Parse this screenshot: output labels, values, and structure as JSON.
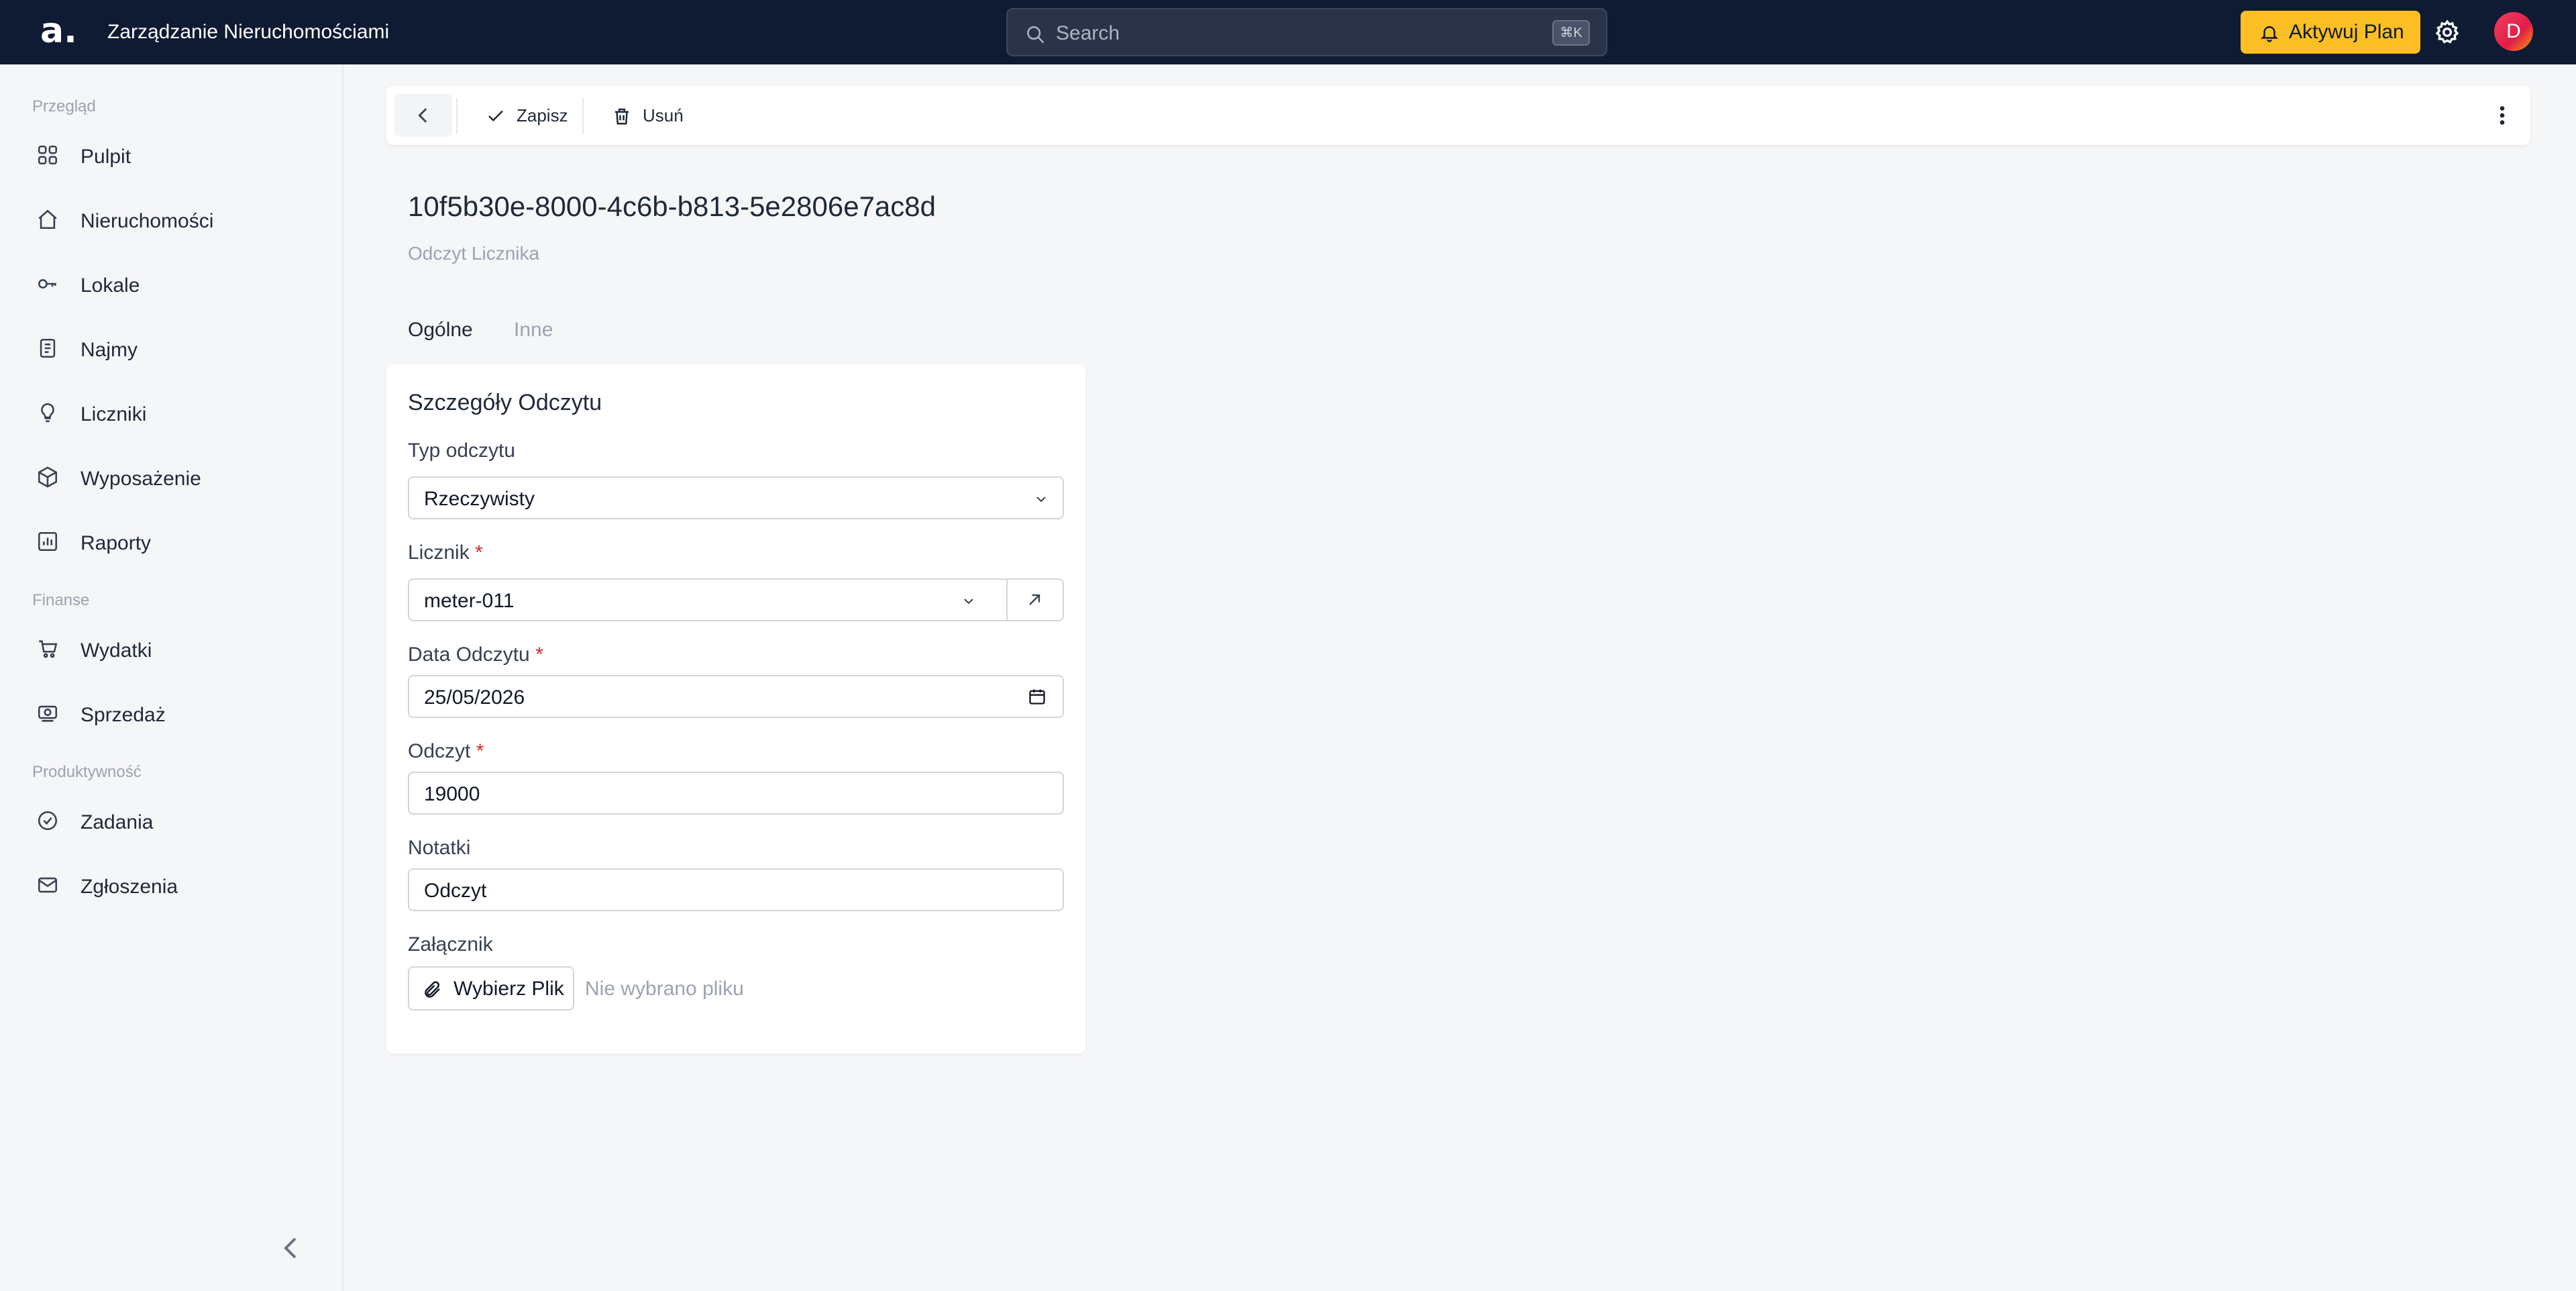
{
  "header": {
    "logo": "a.",
    "app_title": "Zarządzanie Nieruchomościami",
    "search_placeholder": "Search",
    "search_shortcut": "⌘K",
    "upgrade_label": "Aktywuj Plan",
    "avatar_initial": "D",
    "colors": {
      "bar": "#0f1a33",
      "upgrade": "#fbbf24"
    }
  },
  "sidebar": {
    "sections": [
      {
        "label": "Przegląd",
        "items": [
          "Pulpit",
          "Nieruchomości",
          "Lokale",
          "Najmy",
          "Liczniki",
          "Wyposażenie",
          "Raporty"
        ]
      },
      {
        "label": "Finanse",
        "items": [
          "Wydatki",
          "Sprzedaż"
        ]
      },
      {
        "label": "Produktywność",
        "items": [
          "Zadania",
          "Zgłoszenia"
        ]
      }
    ],
    "icons": [
      "grid-icon",
      "house-icon",
      "key-icon",
      "document-icon",
      "lightbulb-icon",
      "box-icon",
      "chart-icon",
      "cart-icon",
      "cash-icon",
      "check-circle-icon",
      "mail-icon"
    ]
  },
  "toolbar": {
    "save_label": "Zapisz",
    "delete_label": "Usuń"
  },
  "record": {
    "id": "10f5b30e-8000-4c6b-b813-5e2806e7ac8d",
    "type": "Odczyt Licznika"
  },
  "tabs": [
    {
      "label": "Ogólne",
      "active": true
    },
    {
      "label": "Inne",
      "active": false
    }
  ],
  "form": {
    "title": "Szczegóły Odczytu",
    "reading_type": {
      "label": "Typ odczytu",
      "value": "Rzeczywisty"
    },
    "meter": {
      "label": "Licznik",
      "required_mark": "*",
      "value": "meter-011"
    },
    "reading_date": {
      "label": "Data Odczytu",
      "required_mark": "*",
      "value": "25/05/2026"
    },
    "reading": {
      "label": "Odczyt",
      "required_mark": "*",
      "value": "19000"
    },
    "notes": {
      "label": "Notatki",
      "value": "Odczyt"
    },
    "attachment": {
      "label": "Załącznik",
      "button_label": "Wybierz Plik",
      "status": "Nie wybrano pliku"
    }
  }
}
